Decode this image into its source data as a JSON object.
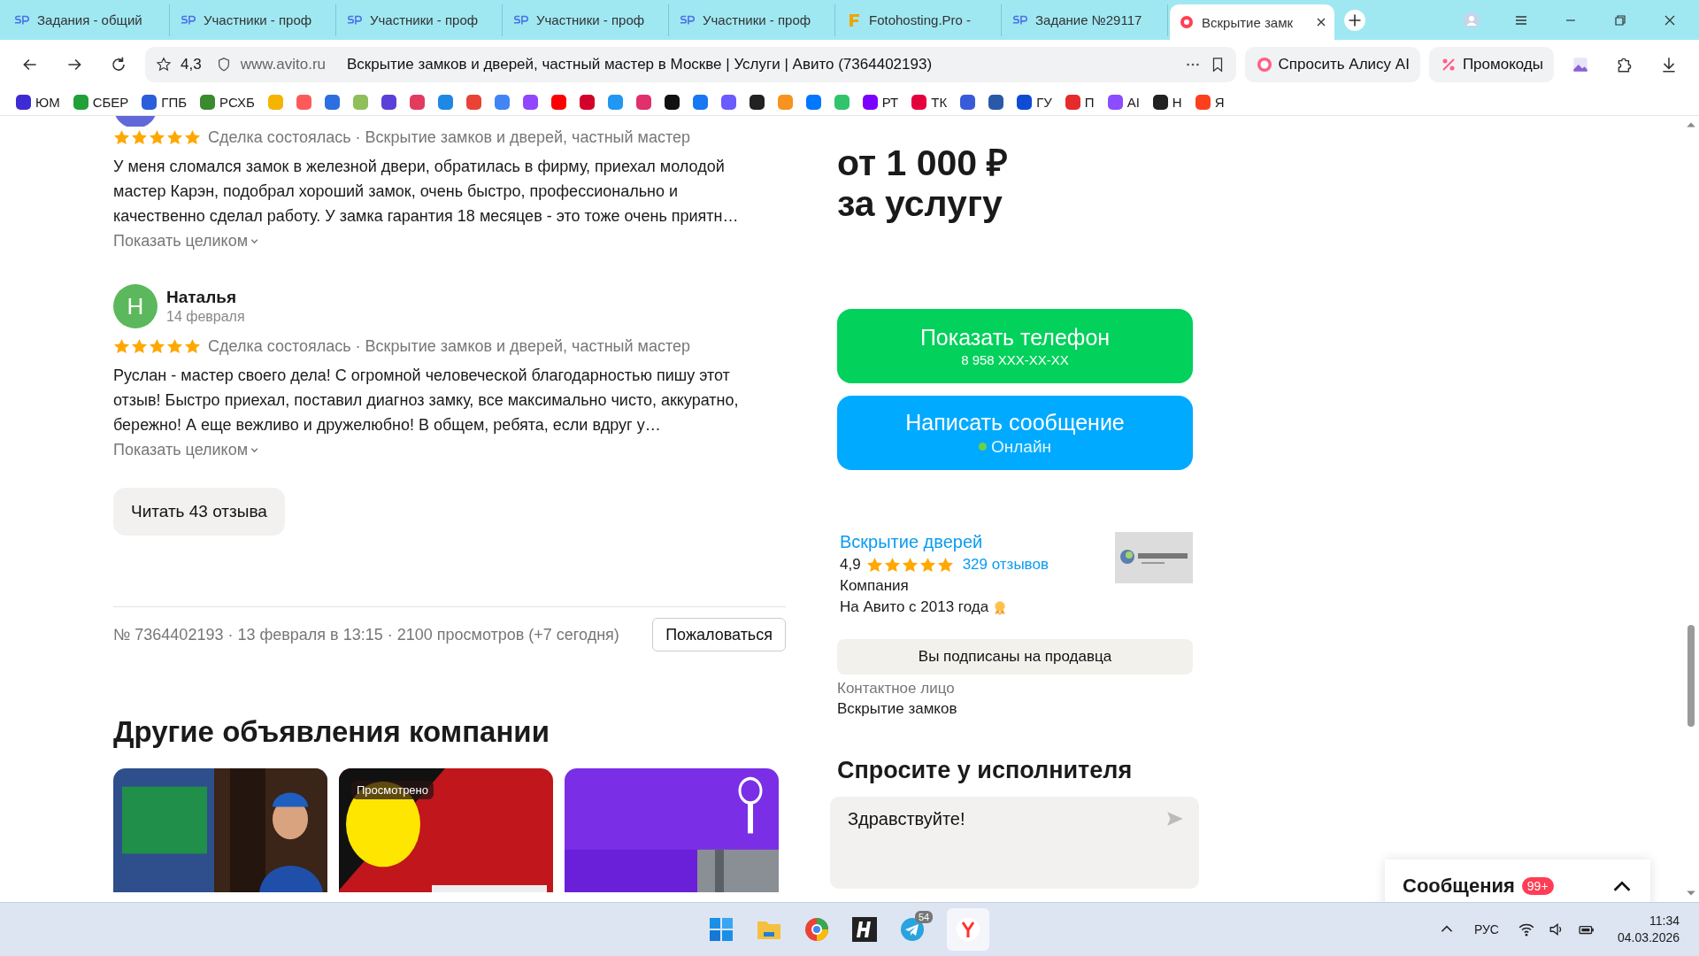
{
  "tabs": [
    {
      "label": "Задания - общий",
      "kind": "sp",
      "selected": false
    },
    {
      "label": "Участники - проф",
      "kind": "sp",
      "selected": false
    },
    {
      "label": "Участники - проф",
      "kind": "sp",
      "selected": false
    },
    {
      "label": "Участники - проф",
      "kind": "sp",
      "selected": false
    },
    {
      "label": "Участники - проф",
      "kind": "sp",
      "selected": false
    },
    {
      "label": "Fotohosting.Pro -",
      "kind": "f",
      "selected": false
    },
    {
      "label": "Задание №29117",
      "kind": "sp",
      "selected": false
    },
    {
      "label": "Вскрытие замк",
      "kind": "record",
      "selected": true
    }
  ],
  "address_bar": {
    "rating": "4,3",
    "domain": "www.avito.ru",
    "title": "Вскрытие замков и дверей, частный мастер в Москве | Услуги | Авито (7364402193)",
    "alice_button": "Спросить Алису AI",
    "promo_button": "Промокоды"
  },
  "bookmarks": [
    {
      "label": "ЮМ",
      "color": "#3d2bd6"
    },
    {
      "label": "СБЕР",
      "color": "#21a038"
    },
    {
      "label": "ГПБ",
      "color": "#2b5fd9"
    },
    {
      "label": "РСХБ",
      "color": "#3a8a2e"
    },
    {
      "color": "#f5b400"
    },
    {
      "color": "#ff5a5a"
    },
    {
      "color": "#2d6fe0"
    },
    {
      "color": "#8fbf5a"
    },
    {
      "color": "#5a3fd8"
    },
    {
      "color": "#e33b5f"
    },
    {
      "color": "#1e88e5"
    },
    {
      "color": "#ea4335"
    },
    {
      "color": "#4285f4"
    },
    {
      "color": "#9146ff"
    },
    {
      "color": "#ff0000"
    },
    {
      "color": "#d3002a"
    },
    {
      "color": "#2196f3"
    },
    {
      "color": "#e1306c"
    },
    {
      "color": "#111111"
    },
    {
      "color": "#1877f2"
    },
    {
      "color": "#6a5cff"
    },
    {
      "color": "#222222"
    },
    {
      "color": "#f7931e"
    },
    {
      "color": "#0077ff"
    },
    {
      "color": "#31c46b"
    },
    {
      "label": "РТ",
      "color": "#7a00ff"
    },
    {
      "label": "ТК",
      "color": "#e4003a"
    },
    {
      "color": "#3a5bd9"
    },
    {
      "color": "#2a59a8"
    },
    {
      "label": "ГУ",
      "color": "#0d4cd3"
    },
    {
      "label": "П",
      "color": "#e52b2b"
    },
    {
      "label": "AI",
      "color": "#8a4dff"
    },
    {
      "label": "Н",
      "color": "#222222"
    },
    {
      "label": "Я",
      "color": "#fc3f1d"
    }
  ],
  "reviews": [
    {
      "stars": 5,
      "deal": "Сделка состоялась · Вскрытие замков и дверей, частный мастер",
      "text": "У меня сломался замок в железной двери, обратилась в фирму, приехал молодой мастер Карэн, подобрал хороший замок, очень быстро, профессионально и качественно сделал работу. У замка гарантия 18 месяцев - это тоже очень приятн…",
      "more": "Показать целиком",
      "color": "#6168d8"
    },
    {
      "name": "Наталья",
      "initial": "Н",
      "date": "14 февраля",
      "color": "#5cb85c",
      "stars": 5,
      "deal": "Сделка состоялась · Вскрытие замков и дверей, частный мастер",
      "text": "Руслан - мастер своего дела! С огромной человеческой благодарностью пишу этот отзыв! Быстро приехал, поставил диагноз замку, все максимально чисто, аккуратно, бережно! А еще вежливо и дружелюбно! В общем, ребята, если вдруг у…",
      "more": "Показать целиком"
    }
  ],
  "read_reviews_button": "Читать 43 отзыва",
  "meta": "№ 7364402193 · 13 февраля в 13:15 · 2100 просмотров (+7 сегодня)",
  "complain_button": "Пожаловаться",
  "other_ads": {
    "heading": "Другие объявления компании",
    "cards": [
      {
        "kind": "picture",
        "viewed": false
      },
      {
        "kind": "picture",
        "viewed": true,
        "viewed_label": "Просмотрено"
      },
      {
        "kind": "picture",
        "viewed": false
      }
    ]
  },
  "price": {
    "line1": "от 1 000 ₽",
    "line2": "за услугу"
  },
  "phone_button": {
    "label": "Показать телефон",
    "number": "8 958 XXX-XX-XX"
  },
  "message_button": {
    "label": "Написать сообщение",
    "status": "Онлайн",
    "online": true
  },
  "seller": {
    "name": "Вскрытие дверей",
    "rating": "4,9",
    "stars": 5,
    "reviews": "329 отзывов",
    "type": "Компания",
    "since": "На Авито с 2013 года"
  },
  "subscribe_button": "Вы подписаны на продавца",
  "contact": {
    "label": "Контактное лицо",
    "name": "Вскрытие замков"
  },
  "ask": {
    "heading": "Спросите у исполнителя",
    "value": "Здравствуйте!"
  },
  "messages_widget": {
    "label": "Сообщения",
    "badge": "99+"
  },
  "taskbar": {
    "telegram_badge": "54",
    "language": "РУС",
    "time": "11:34",
    "date": "04.03.2026"
  }
}
